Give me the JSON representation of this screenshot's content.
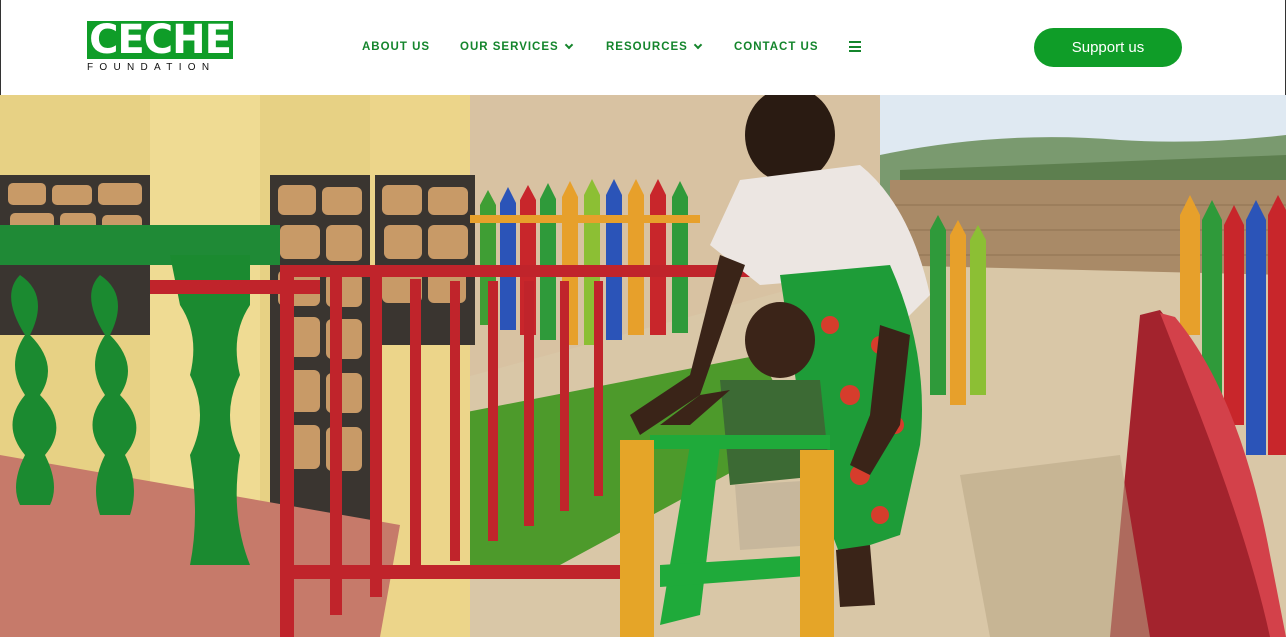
{
  "brand": {
    "logo_main": "CECHE",
    "logo_sub": "FOUNDATION",
    "primary_color": "#0f9d28",
    "nav_color": "#14852c"
  },
  "nav": {
    "items": [
      {
        "label": "ABOUT US",
        "has_dropdown": false
      },
      {
        "label": "OUR SERVICES",
        "has_dropdown": true
      },
      {
        "label": "RESOURCES",
        "has_dropdown": true
      },
      {
        "label": "CONTACT US",
        "has_dropdown": false
      }
    ],
    "menu_icon": "hamburger-icon"
  },
  "cta": {
    "support_label": "Support us"
  },
  "hero": {
    "image_subject": "woman-helping-child-with-walker-in-playground"
  }
}
